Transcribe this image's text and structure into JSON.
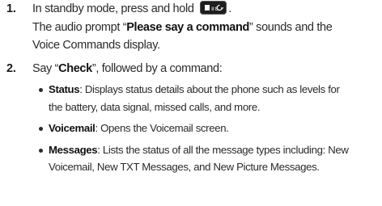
{
  "steps": [
    {
      "number": "1.",
      "line1_text": "In standby mode, press and hold",
      "key_icon": "voice-command-key-icon",
      "line1_end": ".",
      "line2_pre": "The audio prompt “",
      "line2_bold": "Please say a command",
      "line2_post": "” sounds and the",
      "line3": "Voice Commands display."
    },
    {
      "number": "2.",
      "line1_pre": "Say “",
      "line1_bold": "Check",
      "line1_post": "”, followed by a command:",
      "bullets": [
        {
          "term": "Status",
          "lines": [
            ": Displays status details about the phone such as levels for",
            "the battery, data signal, missed calls, and more."
          ]
        },
        {
          "term": "Voicemail",
          "lines": [
            ": Opens the Voicemail screen."
          ]
        },
        {
          "term": "Messages",
          "lines": [
            ": Lists the status of all the message types including: New",
            "Voicemail, New TXT Messages, and New Picture Messages."
          ]
        }
      ]
    }
  ]
}
